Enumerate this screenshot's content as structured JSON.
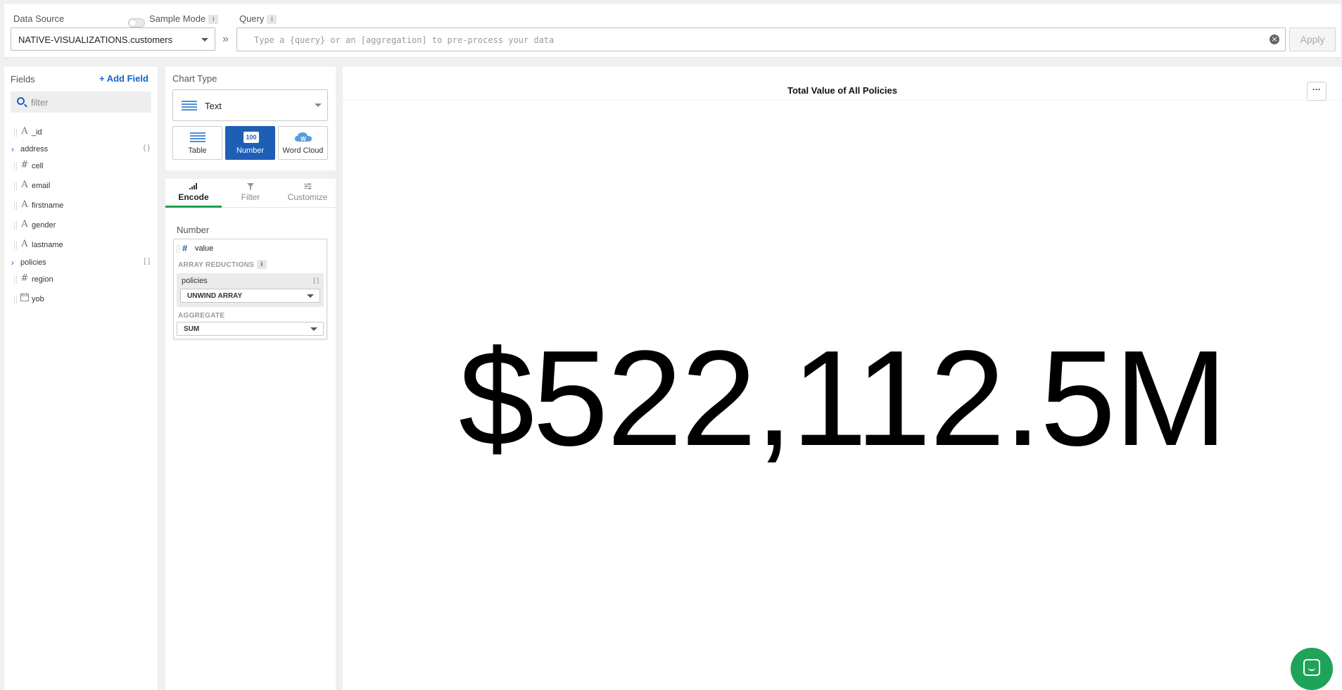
{
  "topbar": {
    "data_source_label": "Data Source",
    "sample_mode_label": "Sample Mode",
    "sample_mode_info": "i",
    "query_label": "Query",
    "query_info": "i",
    "data_source_value": "NATIVE-VISUALIZATIONS.customers",
    "chevron": "»",
    "query_placeholder": "Type a {query} or an [aggregation] to pre-process your data",
    "apply_label": "Apply"
  },
  "fields": {
    "title": "Fields",
    "add_field": "+ Add Field",
    "filter_placeholder": "filter",
    "items": [
      {
        "name": "_id",
        "type": "A"
      },
      {
        "name": "address",
        "type": "object",
        "bracket": "{ }"
      },
      {
        "name": "cell",
        "type": "#"
      },
      {
        "name": "email",
        "type": "A"
      },
      {
        "name": "firstname",
        "type": "A"
      },
      {
        "name": "gender",
        "type": "A"
      },
      {
        "name": "lastname",
        "type": "A"
      },
      {
        "name": "policies",
        "type": "array",
        "bracket": "[ ]"
      },
      {
        "name": "region",
        "type": "#"
      },
      {
        "name": "yob",
        "type": "date"
      }
    ]
  },
  "chart_type": {
    "title": "Chart Type",
    "selected": "Text",
    "buttons": [
      {
        "label": "Table",
        "active": false
      },
      {
        "label": "Number",
        "active": true,
        "badge": "100"
      },
      {
        "label": "Word Cloud",
        "active": false
      }
    ]
  },
  "encode": {
    "tabs": [
      {
        "label": "Encode",
        "active": true
      },
      {
        "label": "Filter",
        "active": false
      },
      {
        "label": "Customize",
        "active": false
      }
    ],
    "channel_label": "Number",
    "field_value": "value",
    "array_reductions_label": "ARRAY REDUCTIONS",
    "array_reductions_info": "i",
    "reduction_field": "policies",
    "reduction_bracket": "[ ]",
    "reduction_value": "UNWIND ARRAY",
    "aggregate_label": "AGGREGATE",
    "aggregate_value": "SUM"
  },
  "chart": {
    "title": "Total Value of All Policies",
    "more_label": "···",
    "value": "$522,112.5M"
  },
  "colors": {
    "accent_blue": "#1264c7",
    "active_button": "#1e5fb6",
    "tab_underline": "#1f9e4f",
    "chat_button": "#1fa35b"
  }
}
